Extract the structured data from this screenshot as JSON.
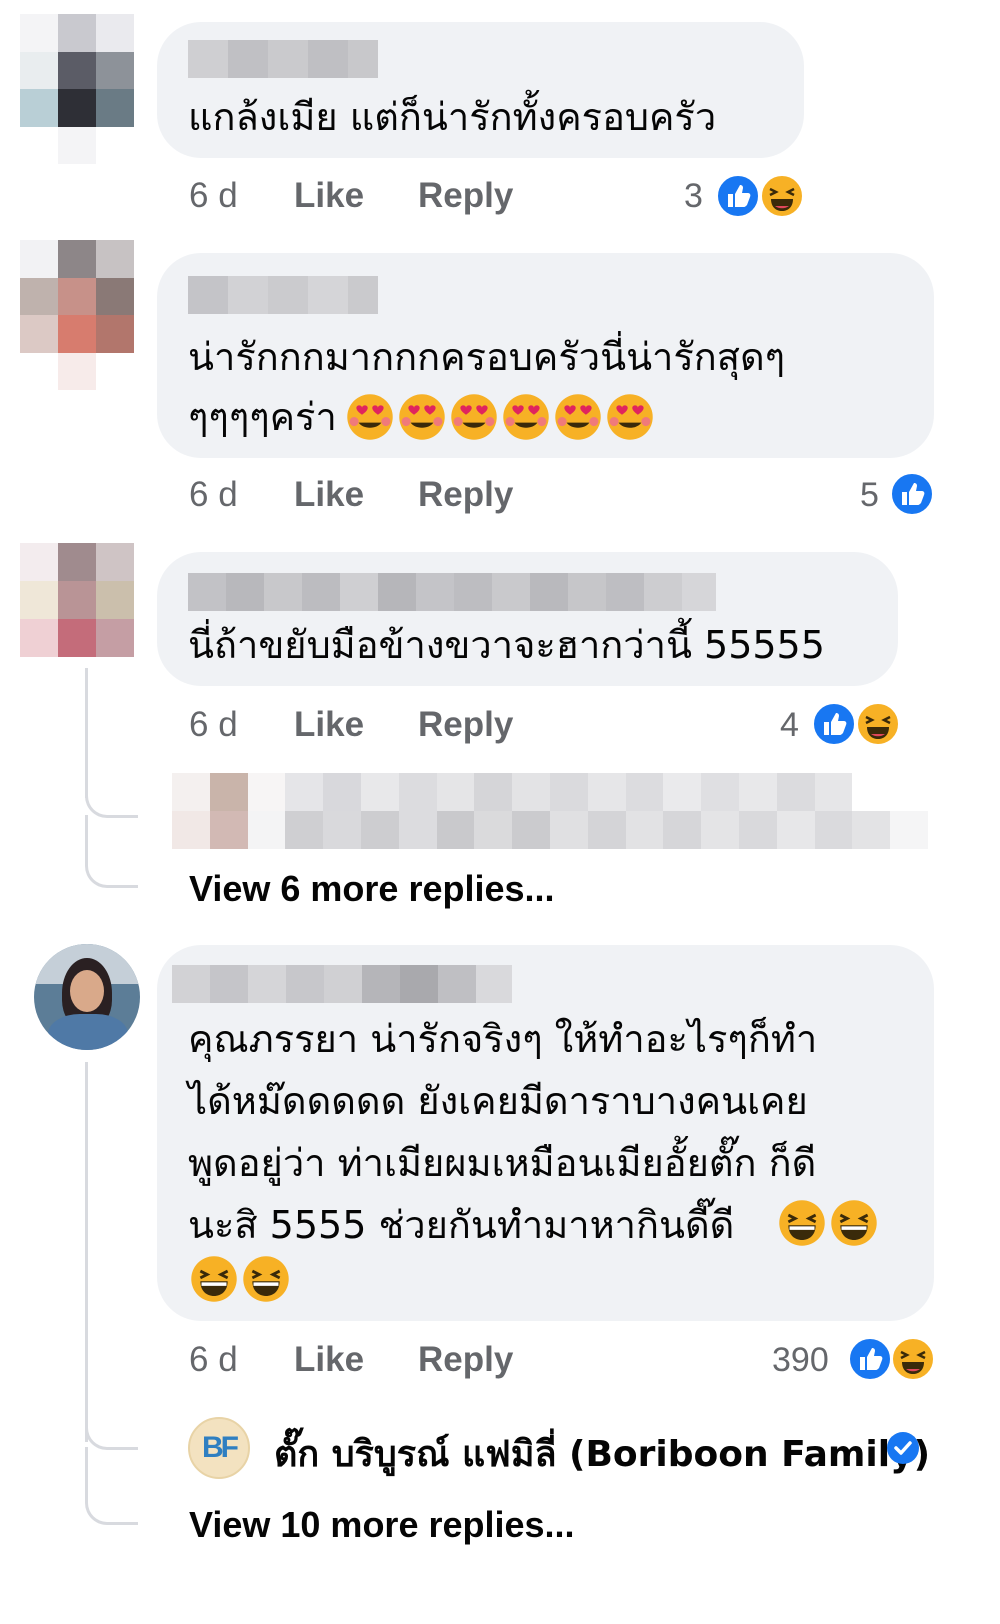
{
  "comments": [
    {
      "text_lines": [
        "แกล้งเมีย แต่ก็น่ารักทั้งครอบครัว"
      ],
      "time": "6 d",
      "like": "Like",
      "reply": "Reply",
      "reaction_count": "3",
      "reactions": [
        "like-icon",
        "haha-icon"
      ]
    },
    {
      "text_lines": [
        "น่ารักกกมากกกครอบครัวนี่น่ารักสุดๆ",
        "ๆๆๆๆคร่า"
      ],
      "emojis": [
        "heart-eyes-icon",
        "heart-eyes-icon",
        "heart-eyes-icon",
        "heart-eyes-icon",
        "heart-eyes-icon",
        "heart-eyes-icon"
      ],
      "time": "6 d",
      "like": "Like",
      "reply": "Reply",
      "reaction_count": "5",
      "reactions": [
        "like-icon"
      ]
    },
    {
      "text_lines": [
        "นี่ถ้าขยับมือข้างขวาจะฮากว่านี้ 55555"
      ],
      "time": "6 d",
      "like": "Like",
      "reply": "Reply",
      "reaction_count": "4",
      "reactions": [
        "like-icon",
        "haha-icon"
      ],
      "view_more": "View 6 more replies..."
    },
    {
      "text_lines": [
        "คุณภรรยา น่ารักจริงๆ ให้ทำอะไรๆก็ทำ",
        "ได้หม๊ดดดดด ยังเคยมีดาราบางคนเคย",
        "พูดอยู่ว่า ท่าเมียผมเหมือนเมียอั้ยตั๊ก ก็ดี",
        "นะสิ 5555 ช่วยกันทำมาหากินดี๊ดี"
      ],
      "time": "6 d",
      "like": "Like",
      "reply": "Reply",
      "reaction_count": "390",
      "reactions": [
        "like-icon",
        "haha-icon"
      ],
      "reply_author": "ตั๊ก บริบูรณ์ แฟมิลี่ (Boriboon Family)",
      "reply_author_logo": "BF",
      "view_more": "View 10 more replies..."
    }
  ],
  "colors": {
    "bubble": "#f0f2f5",
    "meta": "#65676b",
    "like_blue": "#1877f2",
    "haha_yellow": "#f7b125"
  }
}
